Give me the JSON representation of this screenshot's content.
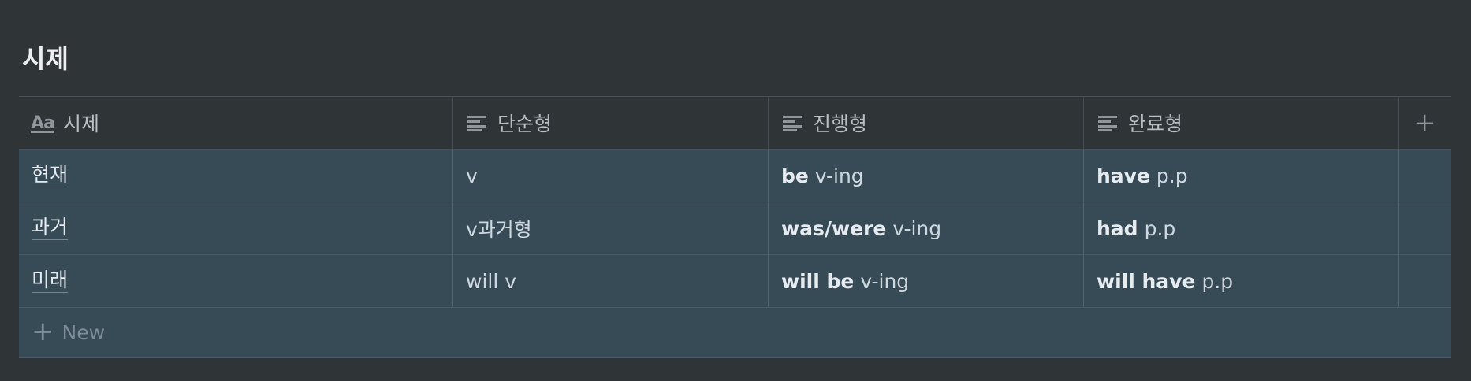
{
  "title": "시제",
  "columns": [
    {
      "label": "시제",
      "icon": "aa-title-icon"
    },
    {
      "label": "단순형",
      "icon": "text-lines-icon"
    },
    {
      "label": "진행형",
      "icon": "text-lines-icon"
    },
    {
      "label": "완료형",
      "icon": "text-lines-icon"
    }
  ],
  "add_column_label": "+",
  "icon_title_glyph": "Aa",
  "rows": [
    {
      "name": "현재",
      "simple": "v",
      "progressive_bold": "be",
      "progressive_rest": "v-ing",
      "perfect_bold": "have",
      "perfect_rest": "p.p"
    },
    {
      "name": "과거",
      "simple": "v과거형",
      "progressive_bold": "was/were",
      "progressive_rest": "v-ing",
      "perfect_bold": "had",
      "perfect_rest": "p.p"
    },
    {
      "name": "미래",
      "simple": "will v",
      "progressive_bold": "will be",
      "progressive_rest": "v-ing",
      "perfect_bold": "will have",
      "perfect_rest": "p.p"
    }
  ],
  "new_row": {
    "plus": "+",
    "label": "New"
  },
  "colors": {
    "background": "#2f3437",
    "row_highlight": "#374b57"
  }
}
